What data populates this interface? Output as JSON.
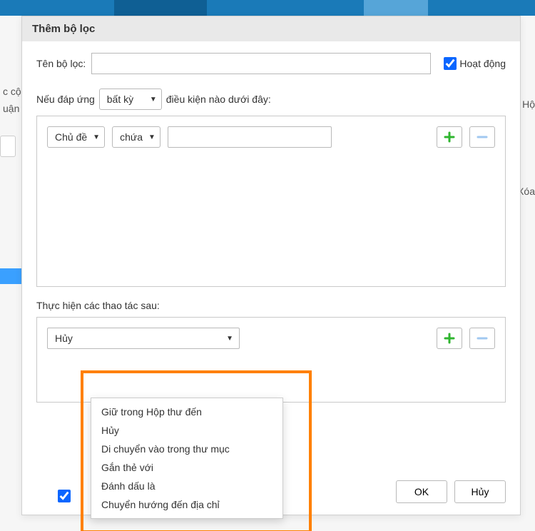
{
  "dialog": {
    "title": "Thêm bộ lọc",
    "name_label": "Tên bộ lọc:",
    "name_value": "",
    "active_label": "Hoạt động",
    "conditions_intro_before": "Nếu đáp ứng",
    "conditions_match_selected": "bất kỳ",
    "conditions_intro_after": "điều kiện nào dưới đây:",
    "criteria": {
      "field_selected": "Chủ đề",
      "op_selected": "chứa",
      "value": ""
    },
    "actions_label": "Thực hiện các thao tác sau:",
    "action_selected": "Hủy",
    "action_options": [
      "Giữ trong Hộp thư đến",
      "Hủy",
      "Di chuyển vào trong thư mục",
      "Gắn thẻ với",
      "Đánh dấu là",
      "Chuyển hướng đến địa chỉ"
    ],
    "buttons": {
      "ok": "OK",
      "cancel": "Hủy"
    }
  },
  "background": {
    "side_labels": [
      "c cộ",
      "uận"
    ],
    "right_labels": [
      "Hộ",
      "Xóa"
    ]
  }
}
